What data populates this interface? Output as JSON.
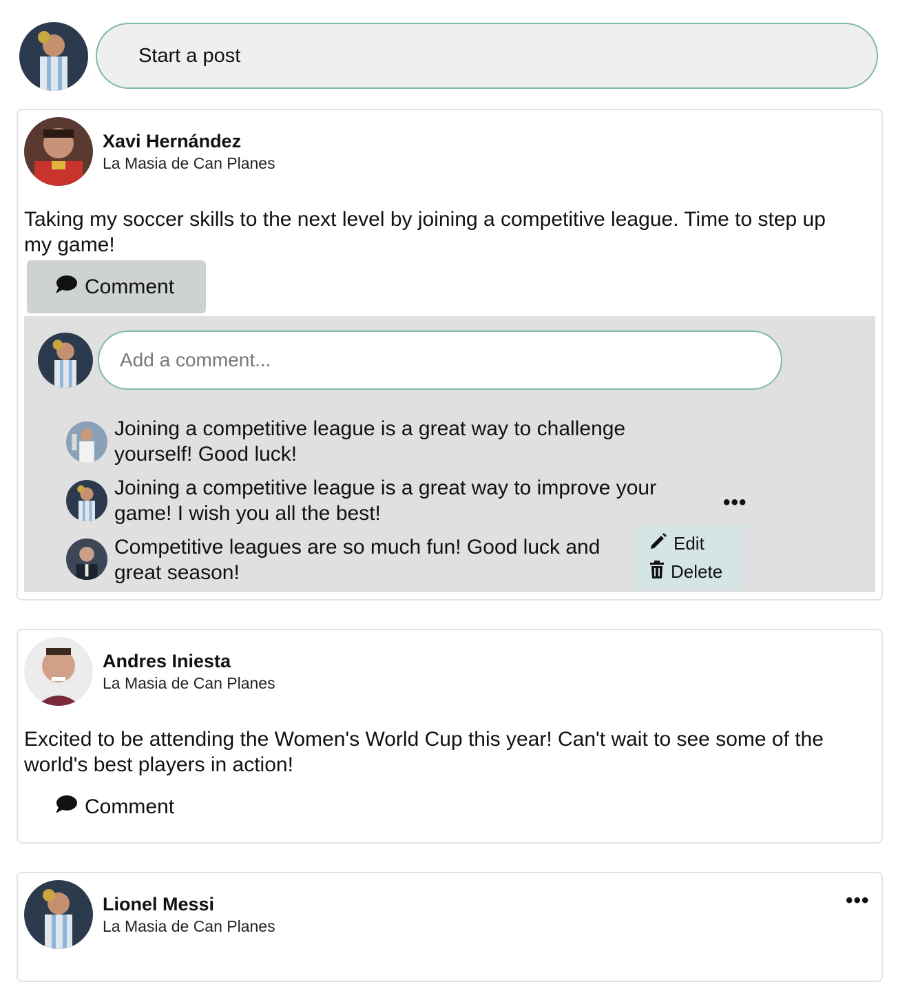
{
  "composer": {
    "placeholder": "Start a post"
  },
  "posts": [
    {
      "author": "Xavi Hernández",
      "organization": "La Masia de Can Planes",
      "text": "Taking my soccer skills to the next level by joining a competitive league. Time to step up my game!",
      "comment_label": "Comment",
      "comment_input_placeholder": "Add a comment...",
      "comments": [
        {
          "text": "Joining a competitive league is a great way to challenge yourself! Good luck!"
        },
        {
          "text": "Joining a competitive league is a great way to improve your game! I wish you all the best!"
        },
        {
          "text": "Competitive leagues are so much fun! Good luck and great season!"
        }
      ],
      "comment_menu": {
        "edit": "Edit",
        "delete": "Delete"
      }
    },
    {
      "author": "Andres Iniesta",
      "organization": "La Masia de Can Planes",
      "text": "Excited to be attending the Women's World Cup this year! Can't wait to see some of the world's best players in action!",
      "comment_label": "Comment"
    },
    {
      "author": "Lionel Messi",
      "organization": "La Masia de Can Planes"
    }
  ],
  "more_menu_glyph": "•••",
  "colors": {
    "accent_border": "#7fb8ad",
    "comment_area_bg": "#e0e0e0",
    "menu_bg": "#d5e4e4"
  }
}
